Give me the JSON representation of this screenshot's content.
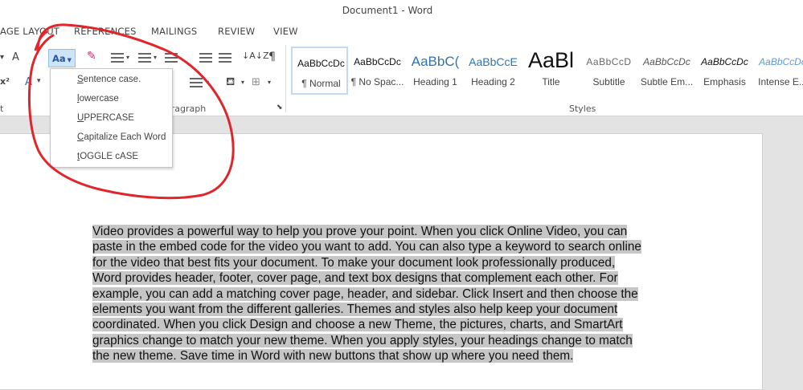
{
  "window": {
    "title": "Document1 - Word"
  },
  "tabs": [
    "AGE LAYOUT",
    "REFERENCES",
    "MAILINGS",
    "REVIEW",
    "VIEW"
  ],
  "ribbon": {
    "change_case_label": "Aa",
    "grow_font_glyph": "A",
    "superscript_glyph": "x²",
    "text_effects_glyph": "A",
    "highlight_glyph": "A",
    "sort_glyph": "↓A↓Z",
    "show_marks_glyph": "¶",
    "groups": {
      "font": "t",
      "paragraph": "aragraph",
      "styles": "Styles"
    }
  },
  "styles_gallery": [
    {
      "sample": "AaBbCcDc",
      "name": "¶ Normal",
      "selected": true
    },
    {
      "sample": "AaBbCcDc",
      "name": "¶ No Spac..."
    },
    {
      "sample": "AaBbC(",
      "name": "Heading 1"
    },
    {
      "sample": "AaBbCcE",
      "name": "Heading 2"
    },
    {
      "sample": "AaBl",
      "name": "Title"
    },
    {
      "sample": "AaBbCcD",
      "name": "Subtitle"
    },
    {
      "sample": "AaBbCcDc",
      "name": "Subtle Em..."
    },
    {
      "sample": "AaBbCcDc",
      "name": "Emphasis"
    },
    {
      "sample": "AaBbCcDc",
      "name": "Intense E..."
    }
  ],
  "change_case_menu": [
    {
      "accel": "S",
      "rest": "entence case."
    },
    {
      "accel": "l",
      "rest": "owercase"
    },
    {
      "accel": "U",
      "rest": "PPERCASE"
    },
    {
      "accel": "C",
      "rest": "apitalize Each Word"
    },
    {
      "accel": "t",
      "rest": "OGGLE cASE"
    }
  ],
  "document": {
    "lines": [
      "Video provides a powerful way to help you prove your point. When you click Online Video, you can",
      "paste in the embed code for the video you want to add. You can also type a keyword to search online",
      "for the video that best fits your document. To make your document look professionally produced,",
      "Word provides header, footer, cover page, and text box designs that complement each other. For",
      "example, you can add a matching cover page, header, and sidebar. Click Insert and then choose the",
      "elements you want from the different galleries. Themes and styles also help keep your document",
      "coordinated. When you click Design and choose a new Theme, the pictures, charts, and SmartArt",
      "graphics change to match your new theme. When you apply styles, your headings change to match",
      "the new theme. Save time in Word with new buttons that show up where you need them."
    ]
  },
  "colors": {
    "annotation": "#e0262b",
    "selection": "#c6c6c6",
    "accent": "#2b579a"
  }
}
